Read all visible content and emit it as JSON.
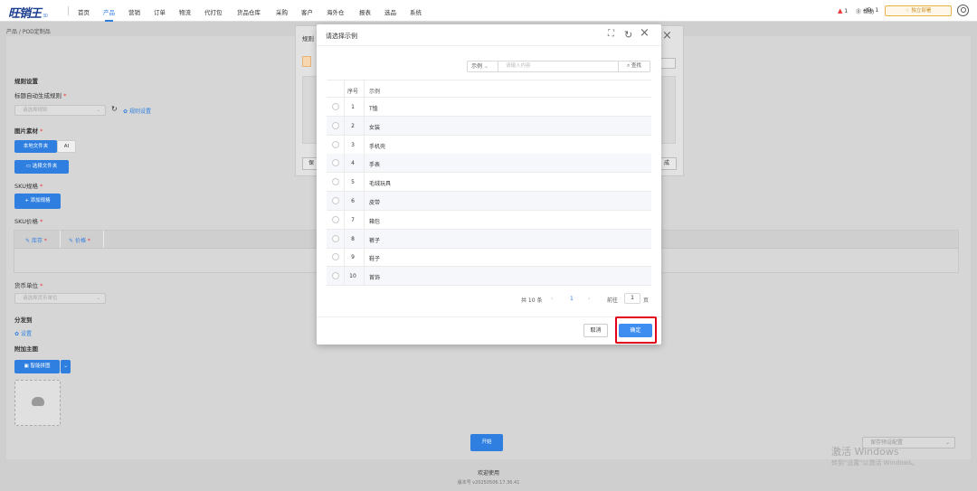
{
  "app": {
    "logo": "旺销王",
    "version": "3.0"
  },
  "nav": [
    {
      "label": "首页",
      "active": false
    },
    {
      "label": "产品",
      "active": true
    },
    {
      "label": "营销",
      "active": false
    },
    {
      "label": "订单",
      "active": false
    },
    {
      "label": "物流",
      "active": false
    },
    {
      "label": "代打包",
      "active": false
    },
    {
      "label": "货品仓库",
      "active": false
    },
    {
      "label": "采购",
      "active": false
    },
    {
      "label": "客户",
      "active": false
    },
    {
      "label": "海外仓",
      "active": false
    },
    {
      "label": "报表",
      "active": false
    },
    {
      "label": "选品",
      "active": false
    },
    {
      "label": "系统",
      "active": false
    }
  ],
  "topright": {
    "alert_count": "1",
    "help": "帮助",
    "id": "ID: 1",
    "shop_btn": "独立部署"
  },
  "breadcrumb": "产品 / POD定制品",
  "form": {
    "rule_settings": "规则设置",
    "title_rule_label": "标题自动生成规则",
    "title_rule_placeholder": "请选择规则",
    "rule_settings_link": "规则设置",
    "image_material": "图片素材",
    "tab_local": "本地文件夹",
    "tab_ai": "AI",
    "select_folder": "选择文件夹",
    "sku_spec": "SKU规格",
    "add_spec": "添加规格",
    "sku_price": "SKU价格",
    "col_stock": "库存",
    "col_price": "价格",
    "currency_label": "货币单位",
    "currency_placeholder": "请选择货币单位",
    "distribute": "分发到",
    "settings_link": "设置",
    "extra_main": "附加主图",
    "smart_combine": "智能拼图",
    "start": "开始",
    "save_select": "保存预设配置"
  },
  "bg_modal": {
    "title": "规则",
    "left_btn": "保",
    "right_btn": "成"
  },
  "modal": {
    "title": "请选择示例",
    "search_type": "示例",
    "search_placeholder": "请输入内容",
    "search_btn": "查找",
    "col_index": "序号",
    "col_name": "示例",
    "rows": [
      {
        "index": "1",
        "name": "T恤"
      },
      {
        "index": "2",
        "name": "女装"
      },
      {
        "index": "3",
        "name": "手机壳"
      },
      {
        "index": "4",
        "name": "手表"
      },
      {
        "index": "5",
        "name": "毛绒玩具"
      },
      {
        "index": "6",
        "name": "皮带"
      },
      {
        "index": "7",
        "name": "箱包"
      },
      {
        "index": "8",
        "name": "裤子"
      },
      {
        "index": "9",
        "name": "鞋子"
      },
      {
        "index": "10",
        "name": "首饰"
      }
    ],
    "pager": {
      "total": "共 10 条",
      "current": "1",
      "goto": "前往",
      "page": "1",
      "page_unit": "页"
    },
    "cancel": "取消",
    "confirm": "确定"
  },
  "footer": {
    "welcome": "欢迎使用",
    "version": "版本号 v20250506.17.36.41"
  },
  "watermark": {
    "line1": "激活 Windows",
    "line2": "转到\"设置\"以激活 Windows。"
  },
  "colors": {
    "primary": "#2f7fe0",
    "confirm": "#3d8ef0",
    "highlight": "#e3001b",
    "overlay": "#cfcfcf"
  }
}
